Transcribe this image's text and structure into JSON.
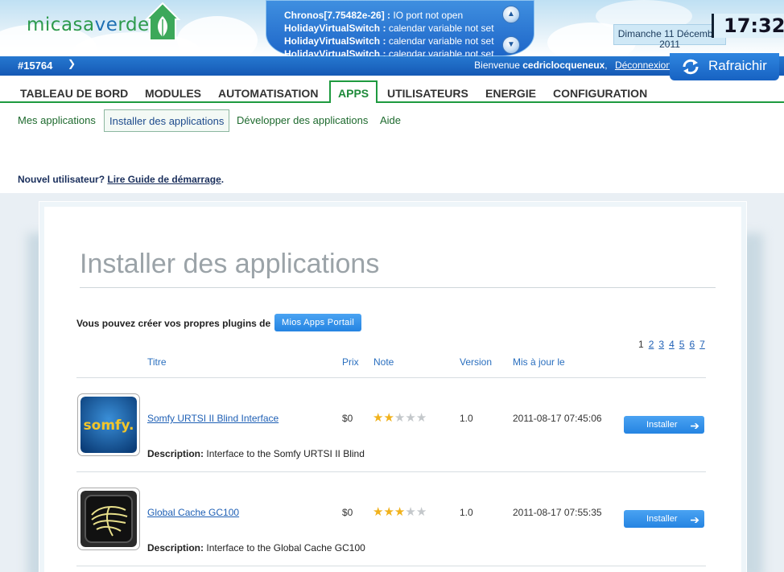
{
  "header": {
    "logo": {
      "part1": "micasa",
      "part2": "ve",
      "part3": "rde"
    },
    "notifications": [
      {
        "source": "Chronos[7.75482e-26] :",
        "message": "IO port not open"
      },
      {
        "source": "HolidayVirtualSwitch :",
        "message": "calendar variable not set"
      },
      {
        "source": "HolidayVirtualSwitch :",
        "message": "calendar variable not set"
      },
      {
        "source": "HolidayVirtualSwitch :",
        "message": "calendar variable not set"
      }
    ],
    "date_line1": "Dimanche 11 Décembre",
    "date_line2": "2011",
    "time": "17:32"
  },
  "bar": {
    "unit_id": "#15764",
    "welcome_prefix": "Bienvenue",
    "username": "cedriclocqueneux",
    "logout": "Déconnexion",
    "refresh": "Rafraichir"
  },
  "nav": {
    "tabs": [
      "TABLEAU DE BORD",
      "MODULES",
      "AUTOMATISATION",
      "APPS",
      "UTILISATEURS",
      "ENERGIE",
      "CONFIGURATION"
    ],
    "active": "APPS"
  },
  "subnav": {
    "items": [
      "Mes applications",
      "Installer des applications",
      "Développer des applications",
      "Aide"
    ],
    "active": "Installer des applications"
  },
  "guide": {
    "prefix": "Nouvel utilisateur?",
    "link": "Lire Guide de démarrage",
    "suffix": "."
  },
  "main": {
    "title": "Installer des applications",
    "portal_text": "Vous pouvez créer vos propres plugins de",
    "portal_button": "Mios Apps Portail",
    "pages": [
      "1",
      "2",
      "3",
      "4",
      "5",
      "6",
      "7"
    ],
    "current_page": "1",
    "columns": {
      "title": "Titre",
      "price": "Prix",
      "rating": "Note",
      "version": "Version",
      "updated": "Mis à jour le"
    },
    "apps": [
      {
        "name": "Somfy URTSI II Blind Interface",
        "price": "$0",
        "rating": 2,
        "rating_max": 5,
        "version": "1.0",
        "updated": "2011-08-17 07:45:06",
        "install": "Installer",
        "desc_label": "Description:",
        "description": "Interface to the Somfy URTSI II Blind",
        "icon": "somfy-logo-icon",
        "icon_text": "somfy."
      },
      {
        "name": "Global Cache GC100",
        "price": "$0",
        "rating": 3,
        "rating_max": 5,
        "version": "1.0",
        "updated": "2011-08-17 07:55:35",
        "install": "Installer",
        "desc_label": "Description:",
        "description": "Interface to the Global Cache GC100",
        "icon": "global-cache-icon"
      }
    ]
  },
  "colors": {
    "brand_green": "#1e9a3f",
    "bar_blue": "#1559b5",
    "button_blue": "#2584e2",
    "star": "#f1b21c"
  }
}
